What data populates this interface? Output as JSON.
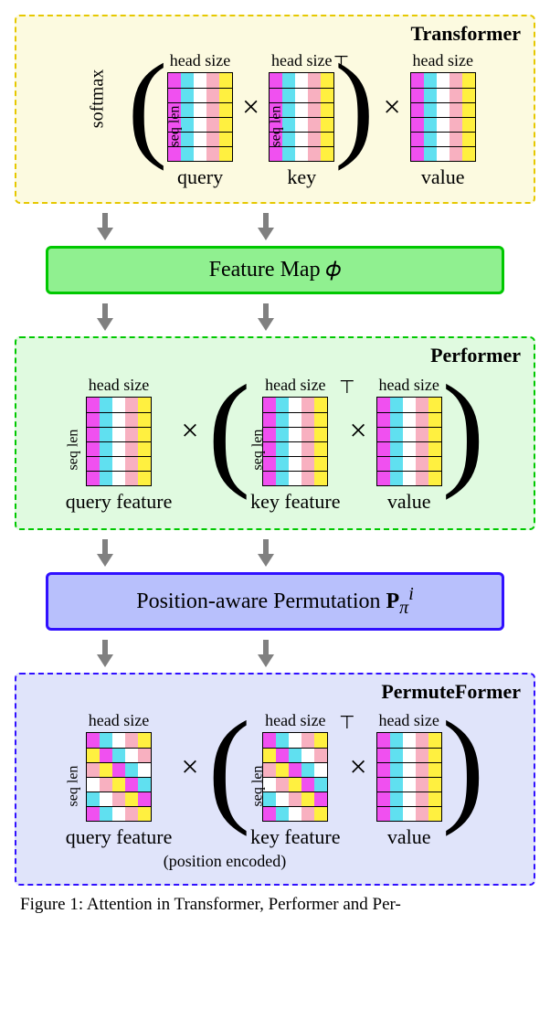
{
  "transformer": {
    "title": "Transformer",
    "softmax": "softmax",
    "seqlen": "seq len",
    "headsize": "head size",
    "query": "query",
    "key": "key",
    "value": "value"
  },
  "performer": {
    "title": "Performer",
    "seqlen": "seq len",
    "headsize": "head size",
    "queryfeat": "query feature",
    "keyfeat": "key feature",
    "value": "value"
  },
  "permuteformer": {
    "title": "PermuteFormer",
    "seqlen": "seq len",
    "headsize": "head size",
    "queryfeat": "query feature",
    "keyfeat": "key feature",
    "value": "value",
    "posencoded": "(position encoded)"
  },
  "featuremap": "Feature Map 𝜙",
  "pospermute_label": "Position-aware Permutation ",
  "pospermute_math": "P",
  "pospermute_sub": "π",
  "pospermute_sup": "i",
  "transpose": "⊤",
  "times": "×",
  "caption": "Figure 1: Attention in Transformer, Performer and Per-"
}
